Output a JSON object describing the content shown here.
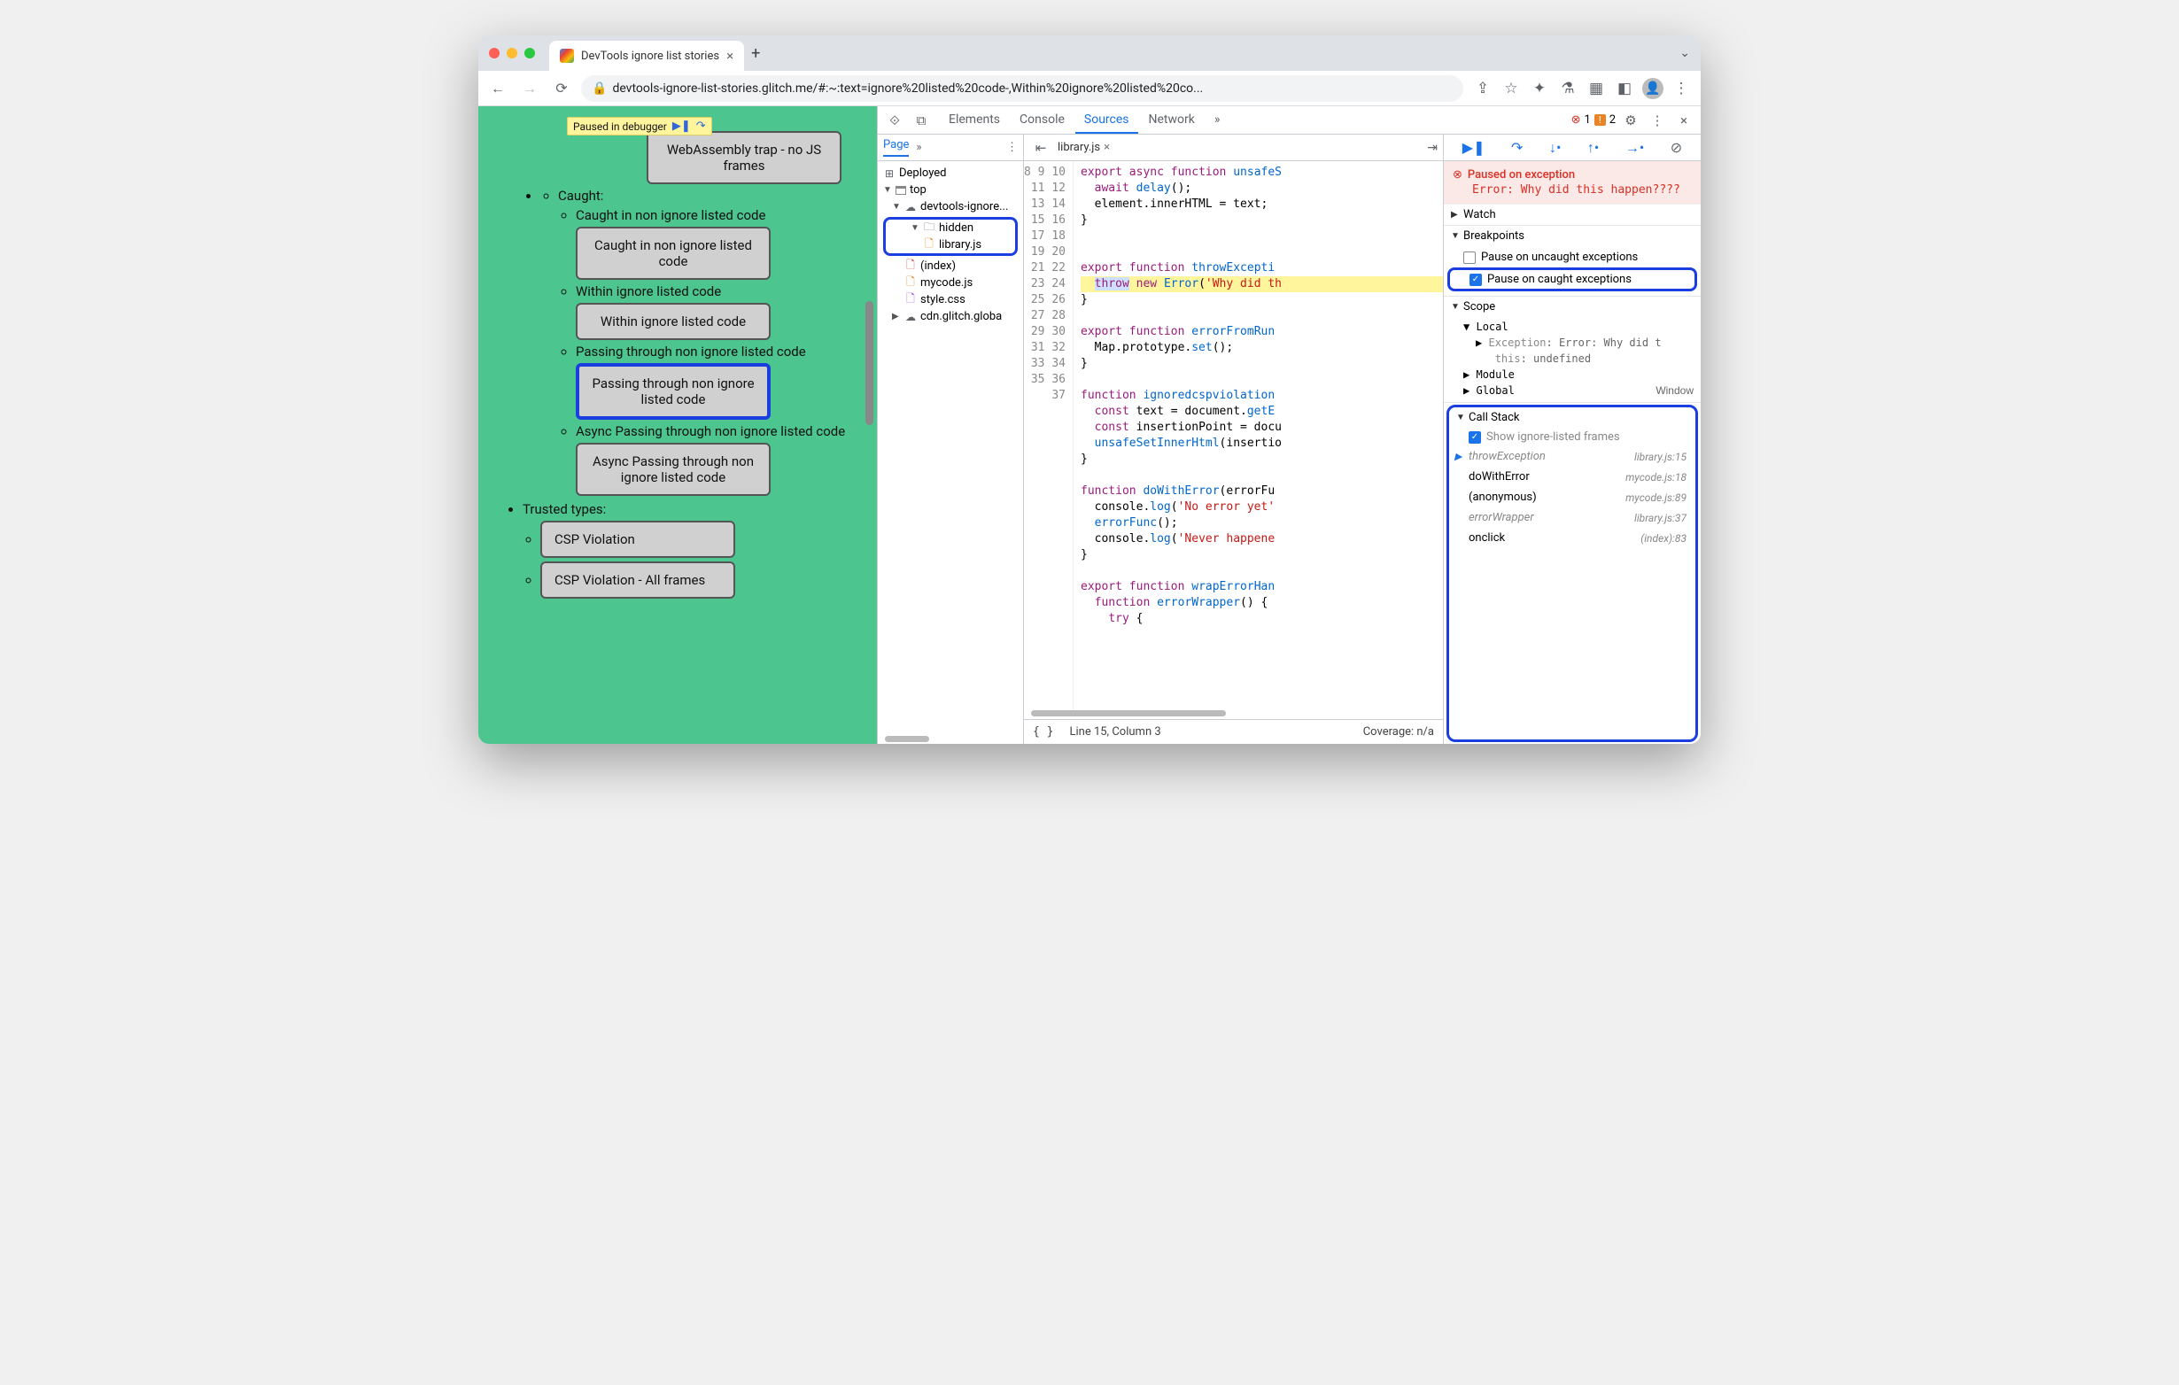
{
  "tab": {
    "title": "DevTools ignore list stories"
  },
  "url": "devtools-ignore-list-stories.glitch.me/#:~:text=ignore%20listed%20code-,Within%20ignore%20listed%20co...",
  "pausedBadge": "Paused in debugger",
  "page": {
    "wasm": "WebAssembly trap - no JS frames",
    "caught": "Caught:",
    "caughtNon": "Caught in non ignore listed code",
    "btnCaughtNon": "Caught in non ignore listed code",
    "within": "Within ignore listed code",
    "btnWithin": "Within ignore listed code",
    "passing": "Passing through non ignore listed code",
    "btnPassing": "Passing through non ignore listed code",
    "asyncPassing": "Async Passing through non ignore listed code",
    "btnAsyncPassing": "Async Passing through non ignore listed code",
    "trusted": "Trusted types:",
    "csp": "CSP Violation",
    "cspAll": "CSP Violation - All frames"
  },
  "devtools": {
    "tabs": [
      "Elements",
      "Console",
      "Sources",
      "Network"
    ],
    "activeTab": "Sources",
    "errors": "1",
    "warnings": "2",
    "pageTab": "Page",
    "tree": {
      "deployed": "Deployed",
      "top": "top",
      "origin": "devtools-ignore...",
      "hidden": "hidden",
      "libjs": "library.js",
      "index": "(index)",
      "mycode": "mycode.js",
      "style": "style.css",
      "cdn": "cdn.glitch.globa"
    },
    "file": "library.js",
    "gutterStart": 8,
    "gutterEnd": 37,
    "code": {
      "l8": "export async function unsafeS",
      "l9": "  await delay();",
      "l10": "  element.innerHTML = text;",
      "l11": "}",
      "l12": "",
      "l13": "",
      "l14": "export function throwExcepti",
      "l15a": "  ",
      "l15throw": "throw",
      "l15b": " new Error('Why did th",
      "l16": "}",
      "l17": "",
      "l18": "export function errorFromRun",
      "l19": "  Map.prototype.set();",
      "l20": "}",
      "l21": "",
      "l22": "function ignoredcspviolation",
      "l23": "  const text = document.getE",
      "l24": "  const insertionPoint = docu",
      "l25": "  unsafeSetInnerHtml(insertio",
      "l26": "}",
      "l27": "",
      "l28": "function doWithError(errorFu",
      "l29": "  console.log('No error yet'",
      "l30": "  errorFunc();",
      "l31": "  console.log('Never happene",
      "l32": "}",
      "l33": "",
      "l34": "export function wrapErrorHan",
      "l35": "  function errorWrapper() {",
      "l36": "    try {"
    },
    "status": {
      "pos": "Line 15, Column 3",
      "coverage": "Coverage: n/a"
    },
    "pause": {
      "title": "Paused on exception",
      "msg": "Error: Why did this happen????"
    },
    "sections": {
      "watch": "Watch",
      "breakpoints": "Breakpoints",
      "pauseUncaught": "Pause on uncaught exceptions",
      "pauseCaught": "Pause on caught exceptions",
      "scope": "Scope",
      "local": "Local",
      "exception": "Exception",
      "exceptionVal": ": Error: Why did t",
      "this": "this",
      "thisVal": ": undefined",
      "module": "Module",
      "global": "Global",
      "globalVal": "Window",
      "callstack": "Call Stack",
      "showIgnored": "Show ignore-listed frames"
    },
    "frames": [
      {
        "name": "throwException",
        "loc": "library.js:15",
        "ignored": true,
        "current": true
      },
      {
        "name": "doWithError",
        "loc": "mycode.js:18",
        "ignored": false
      },
      {
        "name": "(anonymous)",
        "loc": "mycode.js:89",
        "ignored": false
      },
      {
        "name": "errorWrapper",
        "loc": "library.js:37",
        "ignored": true
      },
      {
        "name": "onclick",
        "loc": "(index):83",
        "ignored": false
      }
    ]
  }
}
